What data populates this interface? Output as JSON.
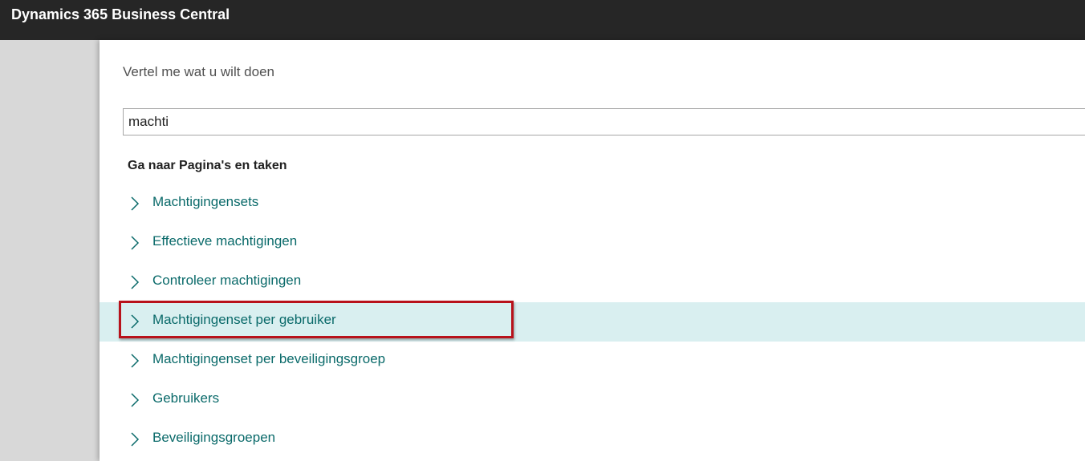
{
  "app": {
    "title": "Dynamics 365 Business Central"
  },
  "tell_me": {
    "prompt": "Vertel me wat u wilt doen",
    "search_value": "machti",
    "section_heading": "Ga naar Pagina's en taken",
    "results": [
      {
        "label": "Machtigingensets",
        "highlighted": false
      },
      {
        "label": "Effectieve machtigingen",
        "highlighted": false
      },
      {
        "label": "Controleer machtigingen",
        "highlighted": false
      },
      {
        "label": "Machtigingenset per gebruiker",
        "highlighted": true
      },
      {
        "label": "Machtigingenset per beveiligingsgroep",
        "highlighted": false
      },
      {
        "label": "Gebruikers",
        "highlighted": false
      },
      {
        "label": "Beveiligingsgroepen",
        "highlighted": false
      }
    ],
    "result_icon": "chevron-right-icon"
  },
  "colors": {
    "topbar": "#262626",
    "link": "#0a6a6a",
    "highlight": "#d9eff0",
    "callout_border": "#b8121b"
  }
}
